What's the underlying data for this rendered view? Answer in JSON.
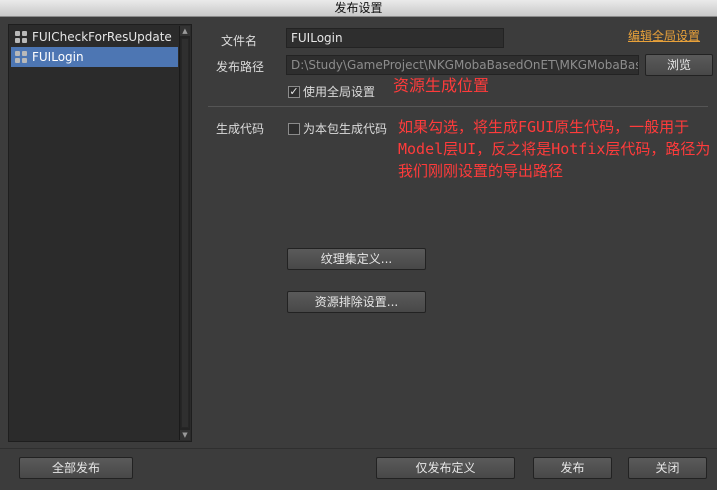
{
  "window": {
    "title": "发布设置"
  },
  "package_list": {
    "items": [
      {
        "label": "FUICheckForResUpdate",
        "selected": false
      },
      {
        "label": "FUILogin",
        "selected": true
      }
    ]
  },
  "form": {
    "file_name_label": "文件名",
    "file_name_value": "FUILogin",
    "edit_global_link": "编辑全局设置",
    "publish_path_label": "发布路径",
    "publish_path_value": "D:\\Study\\GameProject\\NKGMobaBasedOnET\\MKGMobaBasedOr",
    "browse_button": "浏览",
    "use_global_label": "使用全局设置",
    "use_global_checked": true,
    "gen_code_label": "生成代码",
    "gen_code_checkbox_label": "为本包生成代码",
    "gen_code_checked": false,
    "atlas_button": "纹理集定义...",
    "exclude_button": "资源排除设置..."
  },
  "annotations": {
    "path_note": "资源生成位置",
    "code_note_line1": "如果勾选，将生成FGUI原生代码，一般用于",
    "code_note_line2": "Model层UI，反之将是Hotfix层代码，路径为",
    "code_note_line3": "我们刚刚设置的导出路径"
  },
  "footer": {
    "publish_all": "全部发布",
    "publish_definition_only": "仅发布定义",
    "publish": "发布",
    "close": "关闭"
  }
}
